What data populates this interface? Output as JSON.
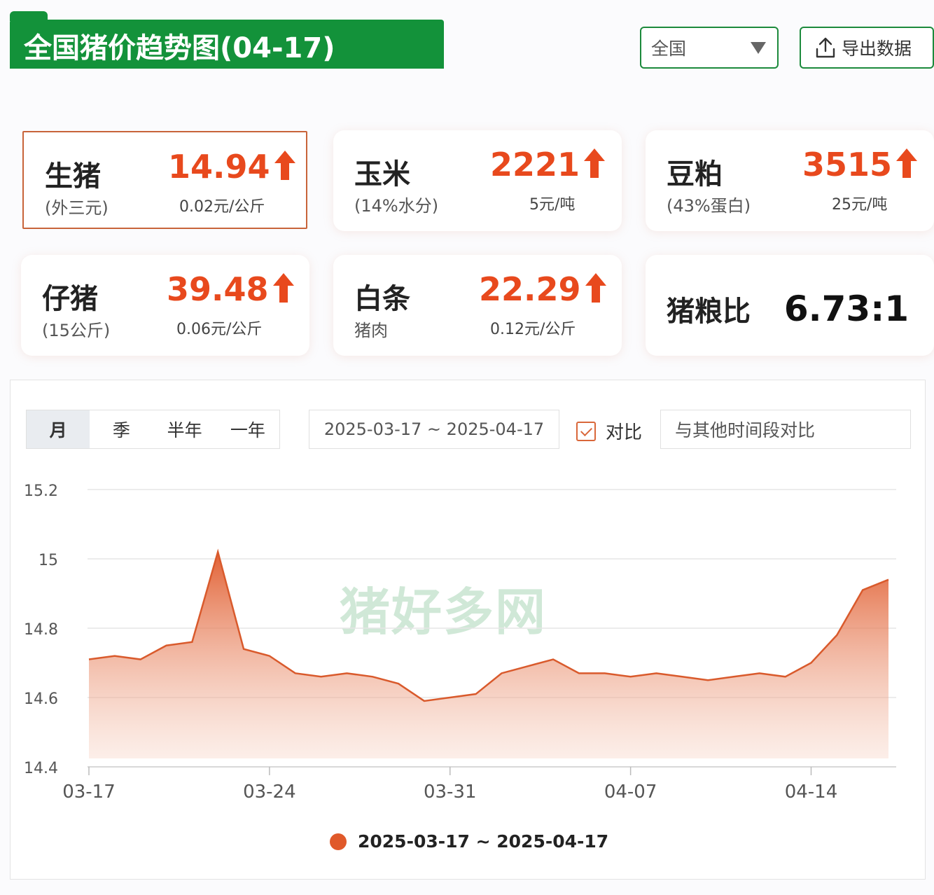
{
  "header": {
    "title": "全国猪价趋势图(04-17)",
    "region_value": "全国",
    "export_label": "导出数据"
  },
  "cards": [
    {
      "name": "生猪",
      "sub": "(外三元)",
      "price": "14.94",
      "delta": "0.02元/公斤",
      "trend": "up"
    },
    {
      "name": "玉米",
      "sub": "(14%水分)",
      "price": "2221",
      "delta": "5元/吨",
      "trend": "up"
    },
    {
      "name": "豆粕",
      "sub": "(43%蛋白)",
      "price": "3515",
      "delta": "25元/吨",
      "trend": "up"
    },
    {
      "name": "仔猪",
      "sub": "(15公斤)",
      "price": "39.48",
      "delta": "0.06元/公斤",
      "trend": "up"
    },
    {
      "name": "白条",
      "sub": "猪肉",
      "price": "22.29",
      "delta": "0.12元/公斤",
      "trend": "up"
    },
    {
      "name": "猪粮比",
      "ratio": "6.73:1"
    }
  ],
  "controls": {
    "period_tabs": [
      "月",
      "季",
      "半年",
      "一年"
    ],
    "active_tab": "月",
    "date_range": "2025-03-17 ~ 2025-04-17",
    "compare_label": "对比",
    "compare_checked": true,
    "compare_placeholder": "与其他时间段对比"
  },
  "watermark": "猪好多网",
  "colors": {
    "brand_green": "#13923a",
    "price_up": "#e8491d",
    "series": "#e0592a"
  },
  "chart_data": {
    "type": "area",
    "x": [
      "03-17",
      "03-18",
      "03-19",
      "03-20",
      "03-21",
      "03-22",
      "03-23",
      "03-24",
      "03-25",
      "03-26",
      "03-27",
      "03-28",
      "03-29",
      "03-30",
      "03-31",
      "04-01",
      "04-02",
      "04-03",
      "04-04",
      "04-05",
      "04-06",
      "04-07",
      "04-08",
      "04-09",
      "04-10",
      "04-11",
      "04-12",
      "04-13",
      "04-14",
      "04-15",
      "04-16",
      "04-17"
    ],
    "series": [
      {
        "name": "2025-03-17 ~ 2025-04-17",
        "values": [
          14.71,
          14.72,
          14.71,
          14.75,
          14.76,
          15.02,
          14.74,
          14.72,
          14.67,
          14.66,
          14.67,
          14.66,
          14.64,
          14.59,
          14.6,
          14.61,
          14.67,
          14.69,
          14.71,
          14.67,
          14.67,
          14.66,
          14.67,
          14.66,
          14.65,
          14.66,
          14.67,
          14.66,
          14.7,
          14.78,
          14.91,
          14.94
        ]
      }
    ],
    "xticks": [
      "03-17",
      "03-24",
      "03-31",
      "04-07",
      "04-14"
    ],
    "yticks": [
      14.4,
      14.6,
      14.8,
      15,
      15.2
    ],
    "ylim": [
      14.4,
      15.2
    ],
    "grid": true,
    "legend": "bottom-center"
  }
}
